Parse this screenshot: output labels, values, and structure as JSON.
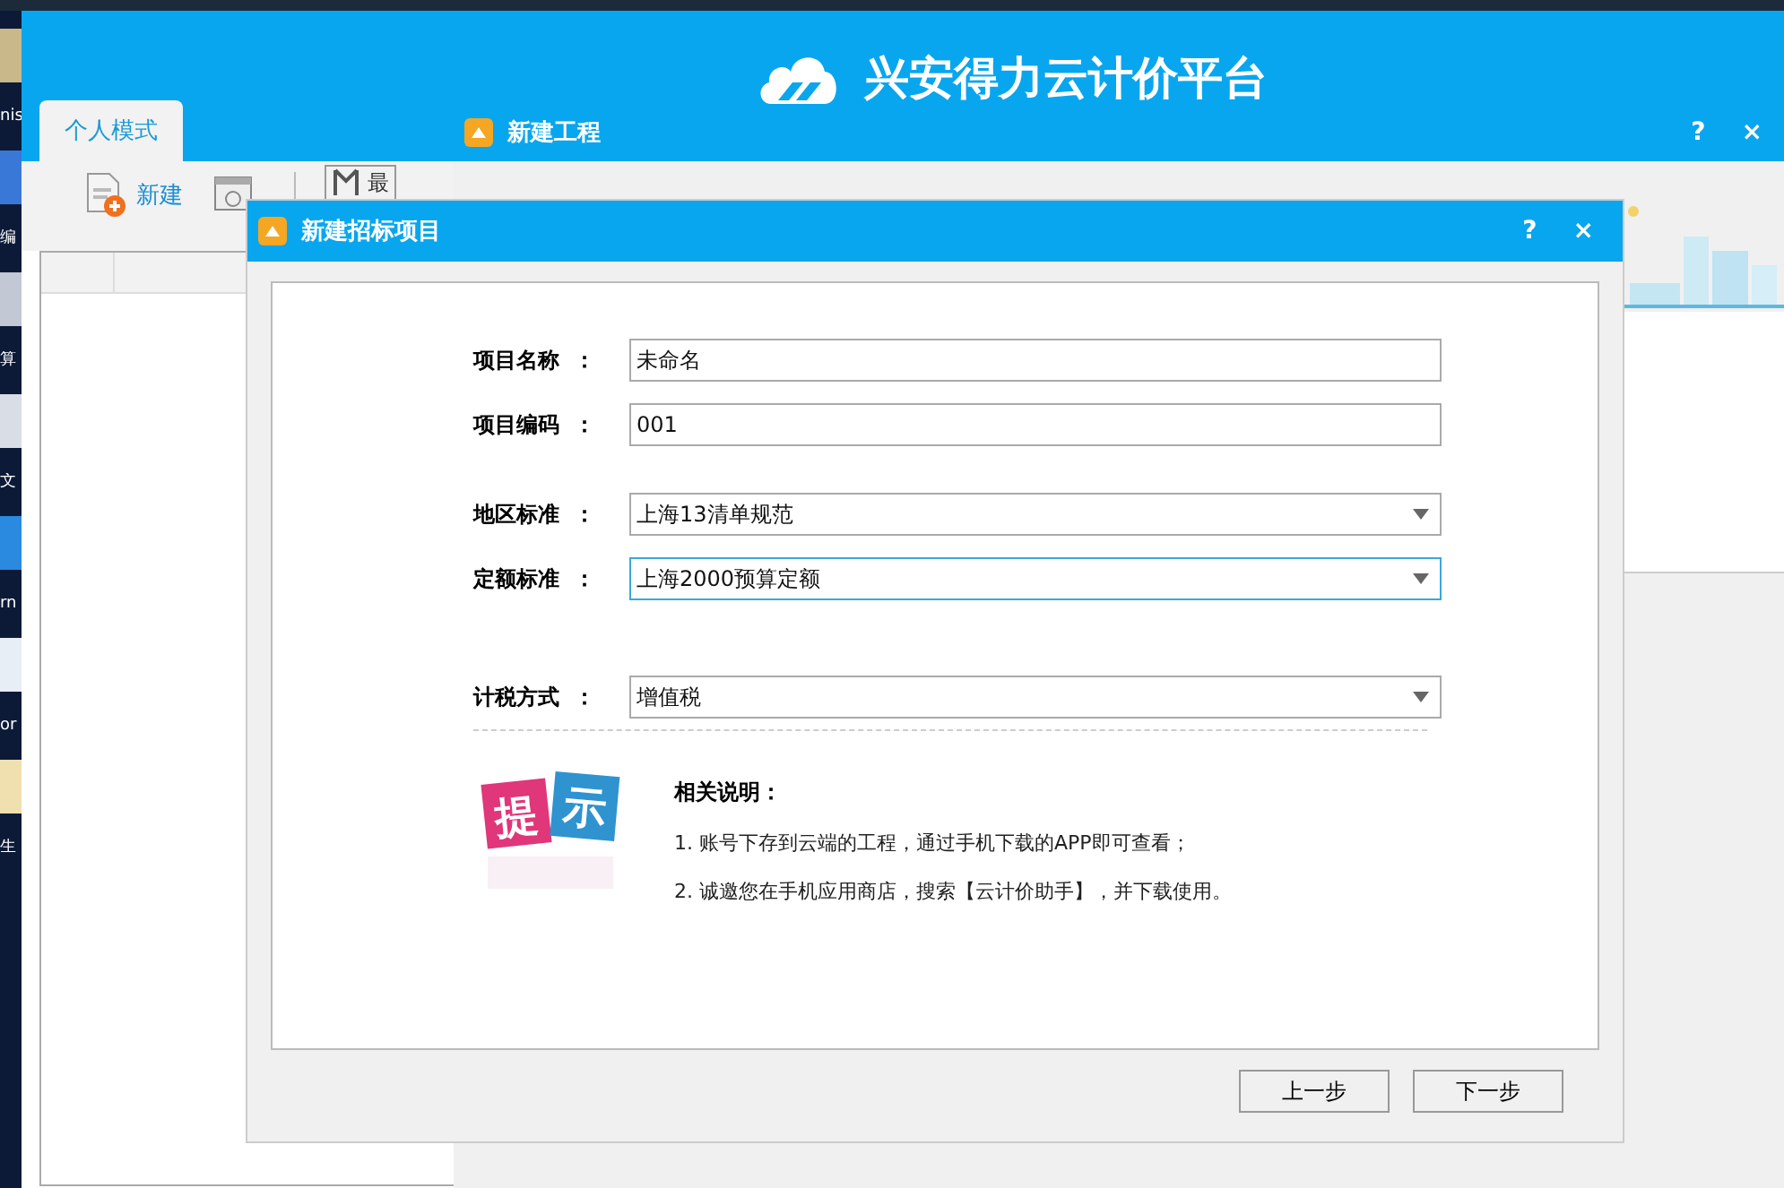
{
  "desktop": {
    "labels": [
      "nis",
      "编",
      "算",
      "文",
      "rn",
      "or",
      "生"
    ]
  },
  "app": {
    "title": "兴安得力云计价平台",
    "tabs": [
      {
        "label": "个人模式",
        "selected": true
      }
    ],
    "toolbar": [
      {
        "kind": "new",
        "label": "新建"
      },
      {
        "kind": "open"
      },
      {
        "kind": "recent",
        "label": "最"
      }
    ]
  },
  "project_dialog": {
    "title": "新建工程",
    "buttons": [
      "?",
      "×"
    ]
  },
  "bid_dialog": {
    "title": "新建招标项目",
    "buttons": [
      "?",
      "×"
    ],
    "fields": [
      {
        "kind": "text",
        "label": "项目名称",
        "colon": "：",
        "value": "未命名",
        "focused": false
      },
      {
        "kind": "text",
        "label": "项目编码",
        "colon": "：",
        "value": "001",
        "focused": false
      },
      {
        "kind": "select",
        "label": "地区标准",
        "colon": "：",
        "value": "上海13清单规范",
        "focused": false
      },
      {
        "kind": "select",
        "label": "定额标准",
        "colon": "：",
        "value": "上海2000预算定额",
        "focused": true
      },
      {
        "kind": "select",
        "label": "计税方式",
        "colon": "：",
        "value": "增值税",
        "focused": false
      }
    ],
    "tip": {
      "badge": [
        "提",
        "示"
      ],
      "heading": "相关说明：",
      "items": [
        "1. 账号下存到云端的工程，通过手机下载的APP即可查看；",
        "2. 诚邀您在手机应用商店，搜索【云计价助手】，并下载使用。"
      ]
    },
    "footer_buttons": [
      "上一步",
      "下一步"
    ]
  }
}
